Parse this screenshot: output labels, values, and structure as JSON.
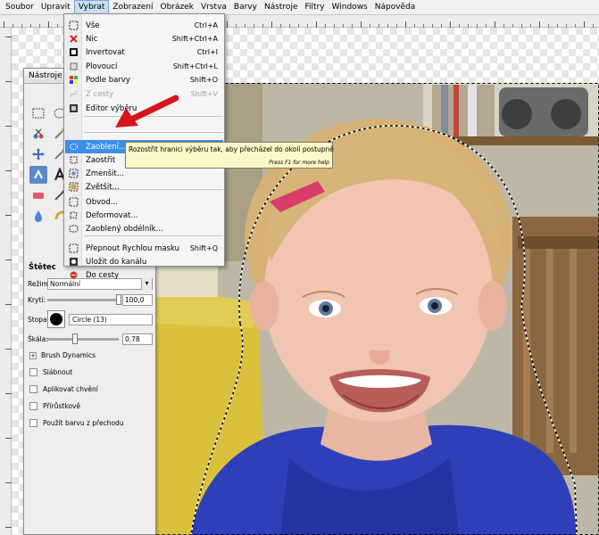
{
  "menubar": {
    "items": [
      "Soubor",
      "Upravit",
      "Vybrat",
      "Zobrazení",
      "Obrázek",
      "Vrstva",
      "Barvy",
      "Nástroje",
      "Filtry",
      "Windows",
      "Nápověda"
    ],
    "active": "Vybrat"
  },
  "toolbox": {
    "title": "Nástroje",
    "options_title": "Štětec",
    "mode_label": "Režim:",
    "mode_value": "Normální",
    "opacity_label": "Krytí:",
    "opacity_value": "100,0",
    "opacity_fraction": 1.0,
    "brush_label": "Stopa:",
    "brush_value": "Circle (13)",
    "scale_label": "Škála:",
    "scale_value": "0,78",
    "scale_fraction": 0.39,
    "brush_dynamics": "Brush Dynamics",
    "checkboxes": [
      "Slábnout",
      "Aplikovat chvění",
      "Přírůstkově",
      "Použít barvu z přechodu"
    ]
  },
  "menu": {
    "items": [
      {
        "label": "Vše",
        "shortcut": "Ctrl+A",
        "icon": "select-all-icon",
        "disabled": false
      },
      {
        "label": "Nic",
        "shortcut": "Shift+Ctrl+A",
        "icon": "select-none-icon",
        "disabled": false
      },
      {
        "label": "Invertovat",
        "shortcut": "Ctrl+I",
        "icon": "invert-selection-icon",
        "disabled": false
      },
      {
        "label": "Plovoucí",
        "shortcut": "Shift+Ctrl+L",
        "icon": "float-selection-icon",
        "disabled": false
      },
      {
        "label": "Podle barvy",
        "shortcut": "Shift+O",
        "icon": "select-by-color-icon",
        "disabled": false
      },
      {
        "label": "Z cesty",
        "shortcut": "Shift+V",
        "icon": "from-path-icon",
        "disabled": true
      },
      {
        "label": "Editor výběru",
        "shortcut": "",
        "icon": "selection-editor-icon",
        "disabled": false
      },
      {
        "label": "Zaoblení...",
        "shortcut": "",
        "icon": "feather-icon",
        "disabled": false,
        "highlighted": true
      },
      {
        "label": "Zaostřit",
        "shortcut": "",
        "icon": "sharpen-selection-icon",
        "disabled": false
      },
      {
        "label": "Zmenšit...",
        "shortcut": "",
        "icon": "shrink-selection-icon",
        "disabled": false
      },
      {
        "label": "Zvětšit...",
        "shortcut": "",
        "icon": "grow-selection-icon",
        "disabled": false
      },
      {
        "label": "Obvod...",
        "shortcut": "",
        "icon": "border-selection-icon",
        "disabled": false
      },
      {
        "label": "Deformovat...",
        "shortcut": "",
        "icon": "distort-selection-icon",
        "disabled": false
      },
      {
        "label": "Zaoblený obdélník...",
        "shortcut": "",
        "icon": "rounded-rectangle-icon",
        "disabled": false
      },
      {
        "label": "Přepnout Rychlou masku",
        "shortcut": "Shift+Q",
        "icon": "quick-mask-icon",
        "disabled": false
      },
      {
        "label": "Uložit do kanálu",
        "shortcut": "",
        "icon": "save-to-channel-icon",
        "disabled": false
      },
      {
        "label": "Do cesty",
        "shortcut": "",
        "icon": "to-path-icon",
        "disabled": false
      }
    ]
  },
  "tooltip": {
    "text": "Rozostřit hranici výběru tak, aby přecházel do okolí postupně",
    "hint": "Press F1 for more help"
  },
  "colors": {
    "menu_highlight": "#3d8ee8",
    "arrow": "#d8141c",
    "tooltip_bg": "#fbf7c8"
  }
}
